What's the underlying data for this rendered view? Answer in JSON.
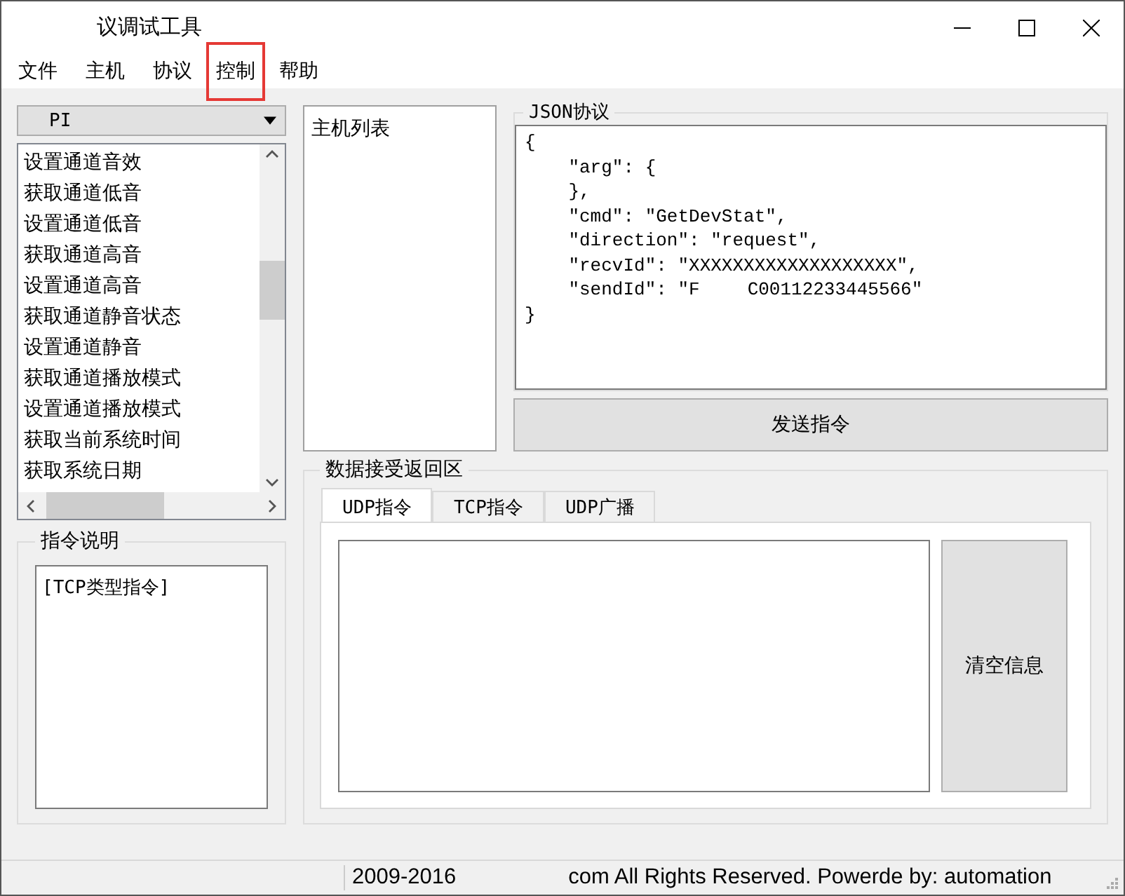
{
  "window": {
    "title": "议调试工具"
  },
  "menu": [
    {
      "label": "文件",
      "highlighted": false
    },
    {
      "label": "主机",
      "highlighted": false
    },
    {
      "label": "协议",
      "highlighted": false
    },
    {
      "label": "控制",
      "highlighted": true
    },
    {
      "label": "帮助",
      "highlighted": false
    }
  ],
  "command_combo": {
    "value": "PI"
  },
  "command_list": [
    "设置通道音效",
    "获取通道低音",
    "设置通道低音",
    "获取通道高音",
    "设置通道高音",
    "获取通道静音状态",
    "设置通道静音",
    "获取通道播放模式",
    "设置通道播放模式",
    "获取当前系统时间",
    "获取系统日期"
  ],
  "description_group": {
    "title": "指令说明",
    "text": "[TCP类型指令]"
  },
  "host_list": {
    "title": "主机列表"
  },
  "json_group": {
    "title": "JSON协议",
    "lines": [
      {
        "text": "{"
      },
      {
        "text": "    \"arg\": {"
      },
      {
        "text": "    },"
      },
      {
        "text": "    \"cmd\": \"GetDevStat\","
      },
      {
        "text": "    \"direction\": \"request\","
      },
      {
        "text": "    \"recvId\": \"XXXXXXXXXXXXXXXXXXX\","
      },
      {
        "text": "    \"sendId\": \"F",
        "after": "C00112233445566\""
      },
      {
        "text": "}"
      }
    ]
  },
  "send_button": "发送指令",
  "receive_group": {
    "title": "数据接受返回区",
    "tabs": [
      {
        "label": "UDP指令",
        "selected": true
      },
      {
        "label": "TCP指令",
        "selected": false
      },
      {
        "label": "UDP广播",
        "selected": false
      }
    ],
    "clear_button": "清空信息"
  },
  "status_bar": {
    "years": "2009-2016",
    "rights": "com All Rights Reserved. Powerde by:  automation"
  }
}
